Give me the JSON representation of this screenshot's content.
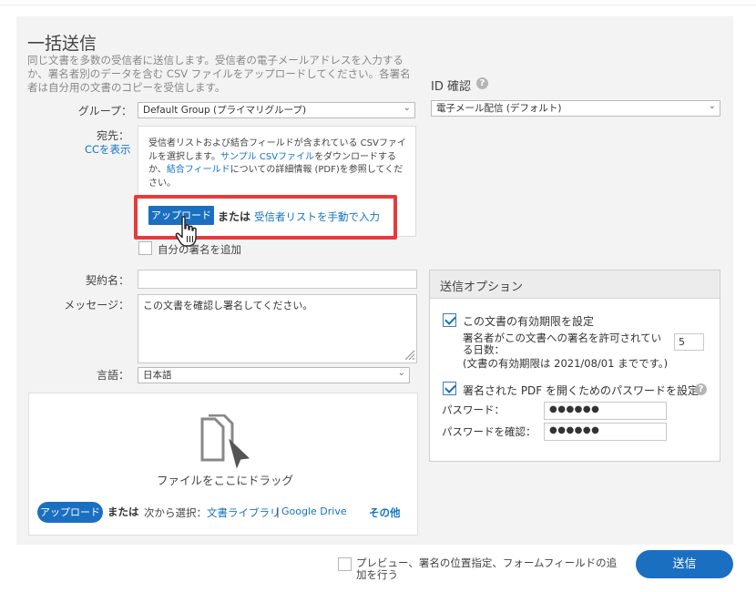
{
  "form": {
    "title": "一括送信",
    "description": "同じ文書を多数の受信者に送信します。受信者の電子メールアドレスを入力するか、署名者別のデータを含む CSV ファイルをアップロードしてください。各署名者は自分用の文書のコピーを受信します。",
    "group_label": "グループ：",
    "group_value": "Default Group (プライマリグループ)",
    "id_check_label": "ID 確認",
    "id_check_value": "電子メール配信 (デフォルト)",
    "recipients_label": "宛先：",
    "cc_link": "CCを表示",
    "recipients_info": {
      "part1": "受信者リストおよび結合フィールドが含まれている CSVファイルを選択します。",
      "sample_link": "サンプル CSVファイル",
      "part2": "をダウンロードするか、",
      "merge_link": "結合フィールド",
      "part3": "についての詳細情報 (PDF)を参照してください。"
    },
    "upload_label": "アップロード",
    "or_label": "または",
    "manual_entry_link": "受信者リストを手動で入力",
    "add_me_label": "自分の署名を追加",
    "agreement_name_label": "契約名：",
    "agreement_name_value": "",
    "message_label": "メッセージ：",
    "message_value": "この文書を確認し署名してください。",
    "language_label": "言語：",
    "language_value": "日本語"
  },
  "file_drop": {
    "drag_text": "ファイルをここにドラッグ",
    "upload_button": "アップロード",
    "or_label": "または",
    "select_from": "次から選択：",
    "library_link": "文書ライブラリ",
    "separator": "|",
    "gdrive_link": "Google Drive",
    "more_link": "その他"
  },
  "send_options": {
    "title": "送信オプション",
    "expiry_label": "この文書の有効期限を設定",
    "expiry_checked": true,
    "days_label_1": "署名者がこの文書への署名を許可されてい",
    "days_label_2": "る日数：",
    "days_value": "5",
    "expiry_note": "(文書の有効期限は 2021/08/01 までです。)",
    "password_label": "署名された PDF を開くためのパスワードを設定",
    "password_checked": true,
    "password_field_label": "パスワード：",
    "password_value": "●●●●●●",
    "confirm_field_label": "パスワードを確認：",
    "confirm_value": "●●●●●●"
  },
  "footer": {
    "preview_label": "プレビュー、署名の位置指定、フォームフィールドの追加を行う",
    "send_button": "送信"
  },
  "colors": {
    "accent": "#1a6fc1",
    "highlight": "#e53b3b",
    "panel_bg": "#f3f3f3"
  }
}
